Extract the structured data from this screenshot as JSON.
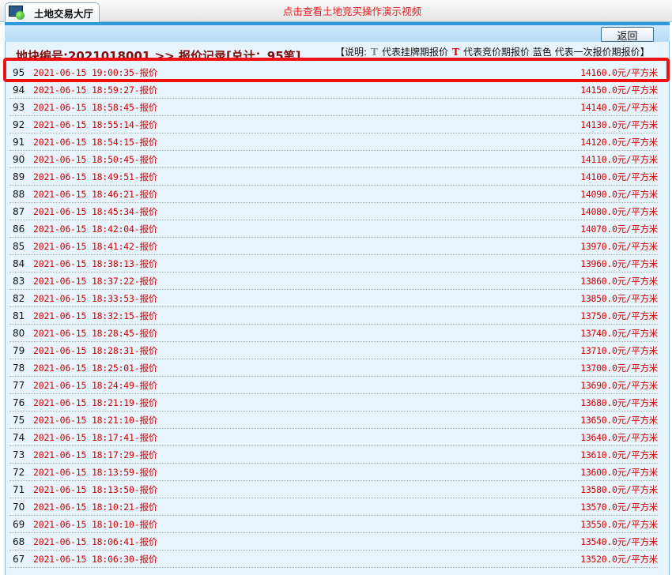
{
  "header": {
    "tab_title": "土地交易大厅",
    "notice_link": "点击查看土地竞买操作演示视频",
    "back_label": "返回"
  },
  "section": {
    "heading": "地块编号:2021018001 >> 报价记录[总计：95笔]",
    "legend": {
      "prefix": "【说明:",
      "gray_t": "T",
      "gray_desc": "代表挂牌期报价",
      "red_t": "T",
      "red_desc": "代表竞价期报价",
      "blue_desc": "蓝色 代表一次报价期报价】"
    }
  },
  "colors": {
    "accent": "#2e9ad8",
    "price": "#d00000",
    "highlight": "#f01010"
  },
  "records": [
    {
      "no": "95",
      "time": "2021-06-15 19:00:35-报价",
      "price": "14160.0元/平方米"
    },
    {
      "no": "94",
      "time": "2021-06-15 18:59:27-报价",
      "price": "14150.0元/平方米"
    },
    {
      "no": "93",
      "time": "2021-06-15 18:58:45-报价",
      "price": "14140.0元/平方米"
    },
    {
      "no": "92",
      "time": "2021-06-15 18:55:14-报价",
      "price": "14130.0元/平方米"
    },
    {
      "no": "91",
      "time": "2021-06-15 18:54:15-报价",
      "price": "14120.0元/平方米"
    },
    {
      "no": "90",
      "time": "2021-06-15 18:50:45-报价",
      "price": "14110.0元/平方米"
    },
    {
      "no": "89",
      "time": "2021-06-15 18:49:51-报价",
      "price": "14100.0元/平方米"
    },
    {
      "no": "88",
      "time": "2021-06-15 18:46:21-报价",
      "price": "14090.0元/平方米"
    },
    {
      "no": "87",
      "time": "2021-06-15 18:45:34-报价",
      "price": "14080.0元/平方米"
    },
    {
      "no": "86",
      "time": "2021-06-15 18:42:04-报价",
      "price": "14070.0元/平方米"
    },
    {
      "no": "85",
      "time": "2021-06-15 18:41:42-报价",
      "price": "13970.0元/平方米"
    },
    {
      "no": "84",
      "time": "2021-06-15 18:38:13-报价",
      "price": "13960.0元/平方米"
    },
    {
      "no": "83",
      "time": "2021-06-15 18:37:22-报价",
      "price": "13860.0元/平方米"
    },
    {
      "no": "82",
      "time": "2021-06-15 18:33:53-报价",
      "price": "13850.0元/平方米"
    },
    {
      "no": "81",
      "time": "2021-06-15 18:32:15-报价",
      "price": "13750.0元/平方米"
    },
    {
      "no": "80",
      "time": "2021-06-15 18:28:45-报价",
      "price": "13740.0元/平方米"
    },
    {
      "no": "79",
      "time": "2021-06-15 18:28:31-报价",
      "price": "13710.0元/平方米"
    },
    {
      "no": "78",
      "time": "2021-06-15 18:25:01-报价",
      "price": "13700.0元/平方米"
    },
    {
      "no": "77",
      "time": "2021-06-15 18:24:49-报价",
      "price": "13690.0元/平方米"
    },
    {
      "no": "76",
      "time": "2021-06-15 18:21:19-报价",
      "price": "13680.0元/平方米"
    },
    {
      "no": "75",
      "time": "2021-06-15 18:21:10-报价",
      "price": "13650.0元/平方米"
    },
    {
      "no": "74",
      "time": "2021-06-15 18:17:41-报价",
      "price": "13640.0元/平方米"
    },
    {
      "no": "73",
      "time": "2021-06-15 18:17:29-报价",
      "price": "13610.0元/平方米"
    },
    {
      "no": "72",
      "time": "2021-06-15 18:13:59-报价",
      "price": "13600.0元/平方米"
    },
    {
      "no": "71",
      "time": "2021-06-15 18:13:50-报价",
      "price": "13580.0元/平方米"
    },
    {
      "no": "70",
      "time": "2021-06-15 18:10:21-报价",
      "price": "13570.0元/平方米"
    },
    {
      "no": "69",
      "time": "2021-06-15 18:10:10-报价",
      "price": "13550.0元/平方米"
    },
    {
      "no": "68",
      "time": "2021-06-15 18:06:41-报价",
      "price": "13540.0元/平方米"
    },
    {
      "no": "67",
      "time": "2021-06-15 18:06:30-报价",
      "price": "13520.0元/平方米"
    }
  ]
}
